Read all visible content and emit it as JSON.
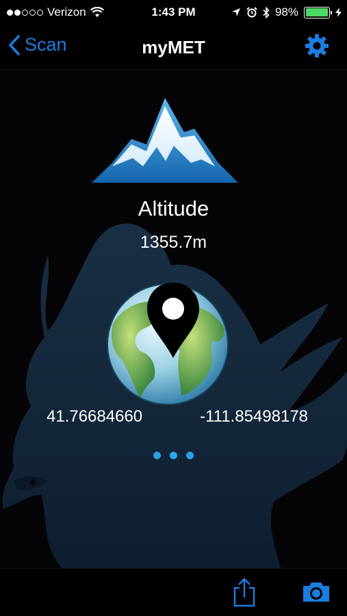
{
  "status_bar": {
    "carrier": "Verizon",
    "time": "1:43 PM",
    "battery_percent": "98%",
    "battery_level": 0.98,
    "signal_bars_filled": 2,
    "signal_bars_total": 5
  },
  "nav": {
    "back_label": "Scan",
    "title": "myMET"
  },
  "main": {
    "altitude_label": "Altitude",
    "altitude_value": "1355.7m",
    "latitude": "41.76684660",
    "longitude": "-111.85498178",
    "page_count": 3,
    "current_page": 1
  },
  "colors": {
    "accent": "#1a7de0",
    "battery_green": "#4cd964",
    "dot_blue": "#2da0e6"
  },
  "icons": {
    "back": "chevron-left-icon",
    "settings": "gear-icon",
    "share": "share-icon",
    "camera": "camera-icon"
  }
}
